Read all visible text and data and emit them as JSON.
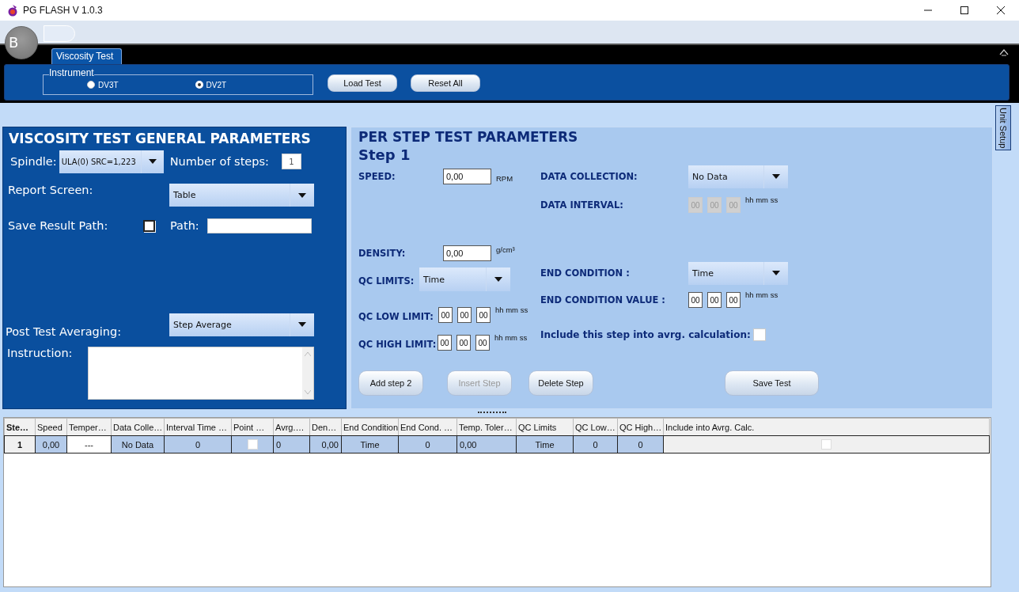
{
  "window": {
    "title": "PG FLASH V 1.0.3"
  },
  "app_menu_button": {
    "label": "B"
  },
  "tabs": [
    {
      "label": "Viscosity Test",
      "selected": true
    }
  ],
  "instrument": {
    "label": "Instrument",
    "options": [
      {
        "label": "DV3T",
        "selected": false
      },
      {
        "label": "DV2T",
        "selected": true
      }
    ]
  },
  "toolbar_buttons": [
    {
      "label": "Load Test"
    },
    {
      "label": "Reset All"
    }
  ],
  "side_tab": {
    "label": "Unit Setup"
  },
  "general_parameters": {
    "title": "VISCOSITY TEST GENERAL PARAMETERS",
    "spindle": {
      "label": "Spindle:",
      "value": "ULA(0) SRC=1,223"
    },
    "number_of_steps": {
      "label": "Number of steps:",
      "value": "1"
    },
    "report_screen": {
      "label": "Report Screen:",
      "value": "Table"
    },
    "save_result_path": {
      "label": "Save Result Path:",
      "checked": false
    },
    "path": {
      "label": "Path:"
    },
    "post_test_averaging": {
      "label": "Post Test Averaging:",
      "value": "Step Average"
    },
    "instruction": {
      "label": "Instruction:"
    }
  },
  "step_parameters": {
    "title": "PER STEP TEST PARAMETERS",
    "step": "Step 1",
    "left_fields": [
      {
        "kind": "number",
        "label": "SPEED:",
        "value": "0,00",
        "unit": "RPM"
      },
      {
        "kind": "number",
        "label": "DENSITY:",
        "value": "0,00",
        "unit": "g/cm³"
      },
      {
        "kind": "combo",
        "label": "QC LIMITS:",
        "value": "Time"
      },
      {
        "kind": "time",
        "label": "QC LOW LIMIT:",
        "values": [
          "00",
          "00",
          "00"
        ],
        "unit": "hh mm ss",
        "disabled": false
      },
      {
        "kind": "time",
        "label": "QC HIGH LIMIT:",
        "values": [
          "00",
          "00",
          "00"
        ],
        "unit": "hh mm ss",
        "disabled": false
      }
    ],
    "right_fields": [
      {
        "kind": "combo",
        "label": "DATA COLLECTION:",
        "value": "No Data"
      },
      {
        "kind": "time",
        "label": "DATA INTERVAL:",
        "values": [
          "00",
          "00",
          "00"
        ],
        "unit": "hh mm ss",
        "disabled": true
      },
      {
        "kind": "combo",
        "label": "END CONDITION :",
        "value": "Time"
      },
      {
        "kind": "time",
        "label": "END CONDITION VALUE :",
        "values": [
          "00",
          "00",
          "00"
        ],
        "unit": "hh mm ss",
        "disabled": false
      },
      {
        "kind": "checkbox",
        "label": "Include this step into avrg. calculation:",
        "checked": false
      }
    ],
    "buttons": [
      {
        "label": "Add step 2",
        "disabled": false
      },
      {
        "label": "Insert Step",
        "disabled": true
      },
      {
        "label": "Delete Step",
        "disabled": false
      },
      {
        "label": "Save Test",
        "disabled": false
      }
    ]
  },
  "table": {
    "columns": [
      "Ste…",
      "Speed",
      "Temper…",
      "Data Colle…",
      "Interval Time …",
      "Point …",
      "Avrg.…",
      "Den…",
      "End Condition",
      "End Cond. …",
      "Temp. Toler…",
      "QC Limits",
      "QC Low…",
      "QC High…",
      "Include into Avrg. Calc."
    ],
    "rows": [
      [
        {
          "kind": "text",
          "text": "1"
        },
        {
          "kind": "text",
          "text": "0,00"
        },
        {
          "kind": "text",
          "text": "---"
        },
        {
          "kind": "text",
          "text": "No Data"
        },
        {
          "kind": "text",
          "text": "0"
        },
        {
          "kind": "checkbox",
          "checked": false
        },
        {
          "kind": "text",
          "text": "0"
        },
        {
          "kind": "text",
          "text": "0,00"
        },
        {
          "kind": "text",
          "text": "Time"
        },
        {
          "kind": "text",
          "text": "0"
        },
        {
          "kind": "text",
          "text": "0,00"
        },
        {
          "kind": "text",
          "text": "Time"
        },
        {
          "kind": "text",
          "text": "0"
        },
        {
          "kind": "text",
          "text": "0"
        },
        {
          "kind": "checkbox",
          "checked": false
        }
      ]
    ]
  }
}
